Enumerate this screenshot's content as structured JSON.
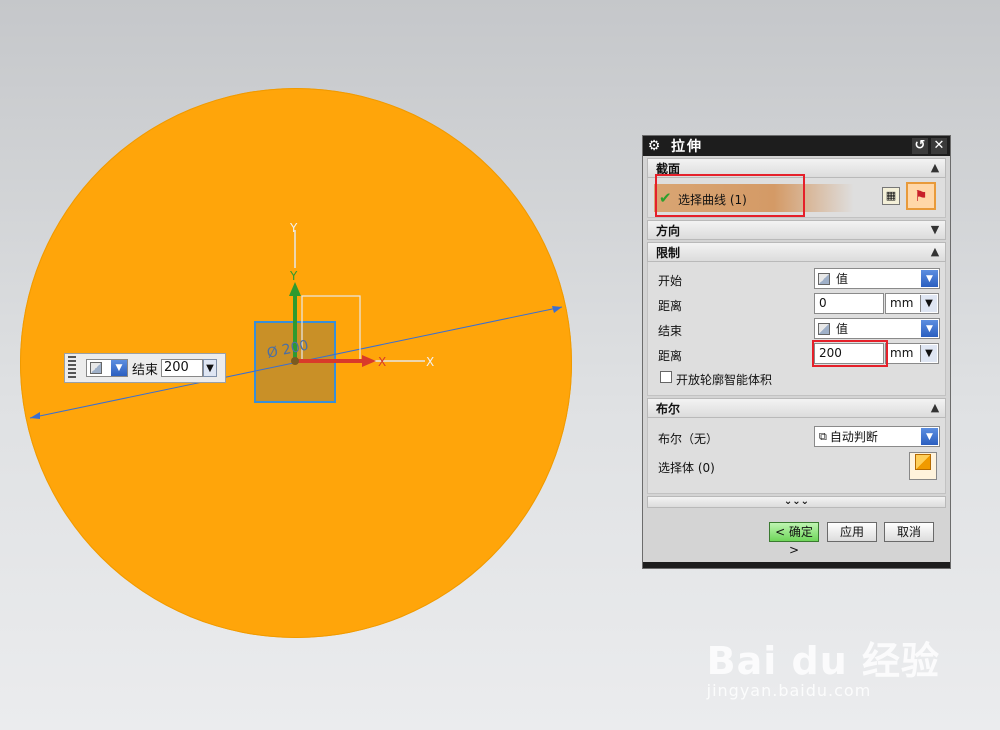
{
  "viewport": {
    "dimension_label": "Ø 200",
    "axes": {
      "x_label": "X",
      "y_label": "Y",
      "x_ghost_label": "X",
      "y_ghost_label": "Y"
    }
  },
  "mini_toolbar": {
    "label": "结束",
    "value": "200"
  },
  "dialog": {
    "title": "拉伸",
    "sections": {
      "section": {
        "header": "截面",
        "select_curve_label": "选择曲线 (1)"
      },
      "direction": {
        "header": "方向"
      },
      "limits": {
        "header": "限制",
        "start_label": "开始",
        "start_option": "值",
        "start_distance_label": "距离",
        "start_distance_value": "0",
        "start_unit": "mm",
        "end_label": "结束",
        "end_option": "值",
        "end_distance_label": "距离",
        "end_distance_value": "200",
        "end_unit": "mm",
        "open_profile_label": "开放轮廓智能体积"
      },
      "boolean": {
        "header": "布尔",
        "boolean_label": "布尔（无）",
        "boolean_option": "自动判断",
        "select_body_label": "选择体 (0)"
      }
    },
    "more_chevrons": "⌄⌄⌄",
    "buttons": {
      "ok": "< 确定 >",
      "apply": "应用",
      "cancel": "取消"
    }
  },
  "watermark": {
    "logo": "Bai du 经验",
    "url": "jingyan.baidu.com"
  }
}
